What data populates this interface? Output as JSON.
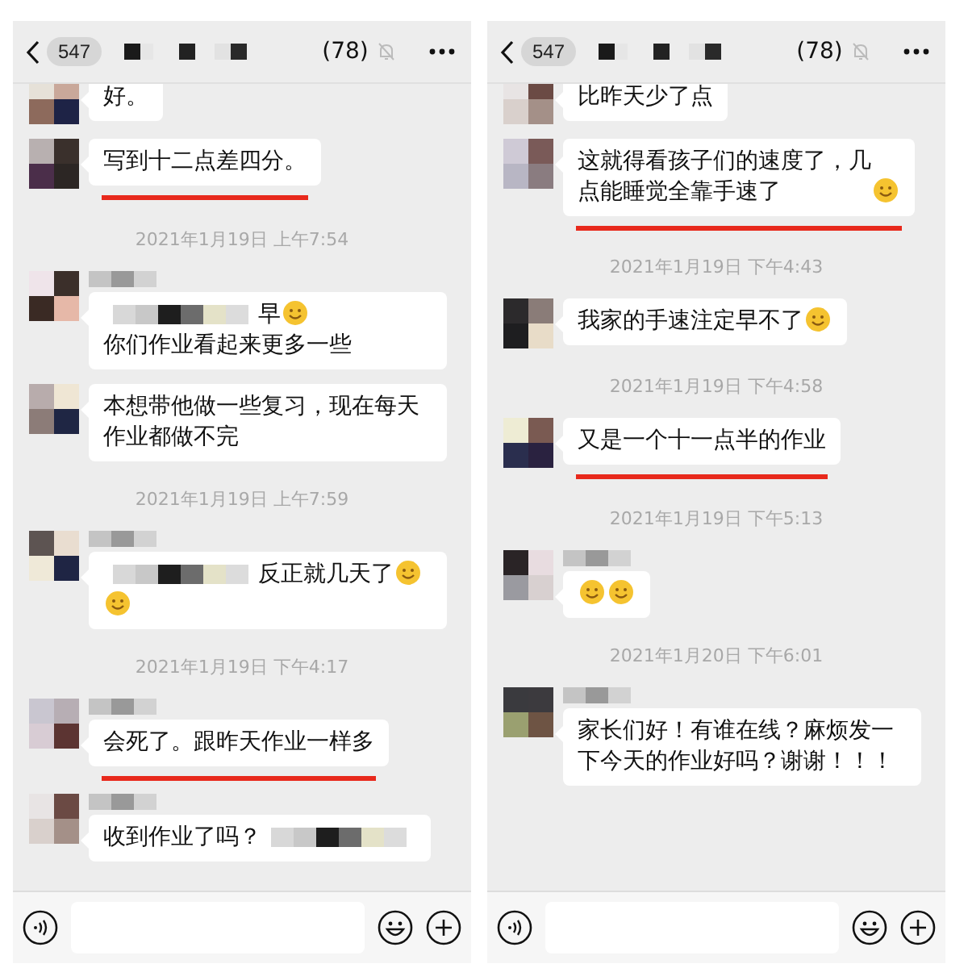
{
  "panels": [
    {
      "header": {
        "back_count": "547",
        "member_count": "(78)",
        "muted": true
      },
      "messages": [
        {
          "kind": "message",
          "name_censored": false,
          "underlined": false,
          "parts": [
            {
              "kind": "text",
              "text": "好。"
            }
          ]
        },
        {
          "kind": "message",
          "name_censored": false,
          "underlined": true,
          "parts": [
            {
              "kind": "text",
              "text": "写到十二点差四分。"
            }
          ]
        },
        {
          "kind": "time",
          "text": "2021年1月19日 上午7:54"
        },
        {
          "kind": "message",
          "name_censored": true,
          "underlined": false,
          "parts": [
            {
              "kind": "censored"
            },
            {
              "kind": "text",
              "text": "早"
            },
            {
              "kind": "emoji"
            },
            {
              "kind": "text",
              "text": "你们作业看起来更多一些"
            }
          ]
        },
        {
          "kind": "message",
          "name_censored": false,
          "underlined": false,
          "parts": [
            {
              "kind": "text",
              "text": "本想带他做一些复习，现在每天作业都做不完"
            }
          ]
        },
        {
          "kind": "time",
          "text": "2021年1月19日 上午7:59"
        },
        {
          "kind": "message",
          "name_censored": true,
          "underlined": false,
          "parts": [
            {
              "kind": "censored"
            },
            {
              "kind": "text",
              "text": "反正就几天了"
            },
            {
              "kind": "emoji"
            },
            {
              "kind": "emoji"
            }
          ]
        },
        {
          "kind": "time",
          "text": "2021年1月19日 下午4:17"
        },
        {
          "kind": "message",
          "name_censored": true,
          "underlined": true,
          "parts": [
            {
              "kind": "text",
              "text": "会死了。跟昨天作业一样多"
            }
          ]
        },
        {
          "kind": "message",
          "name_censored": true,
          "underlined": false,
          "parts": [
            {
              "kind": "text",
              "text": "收到作业了吗？"
            },
            {
              "kind": "censored"
            }
          ]
        }
      ]
    },
    {
      "header": {
        "back_count": "547",
        "member_count": "(78)",
        "muted": true
      },
      "messages": [
        {
          "kind": "message",
          "name_censored": false,
          "underlined": false,
          "parts": [
            {
              "kind": "text",
              "text": "比昨天少了点"
            }
          ]
        },
        {
          "kind": "message",
          "name_censored": false,
          "underlined": true,
          "parts": [
            {
              "kind": "text",
              "text": "这就得看孩子们的速度了，几点能睡觉全靠手速了"
            },
            {
              "kind": "emoji"
            }
          ]
        },
        {
          "kind": "time",
          "text": "2021年1月19日 下午4:43"
        },
        {
          "kind": "message",
          "name_censored": false,
          "underlined": false,
          "parts": [
            {
              "kind": "text",
              "text": "我家的手速注定早不了"
            },
            {
              "kind": "emoji"
            }
          ]
        },
        {
          "kind": "time",
          "text": "2021年1月19日 下午4:58"
        },
        {
          "kind": "message",
          "name_censored": false,
          "underlined": true,
          "parts": [
            {
              "kind": "text",
              "text": "又是一个十一点半的作业"
            }
          ]
        },
        {
          "kind": "time",
          "text": "2021年1月19日 下午5:13"
        },
        {
          "kind": "message",
          "name_censored": true,
          "underlined": false,
          "parts": [
            {
              "kind": "emoji"
            },
            {
              "kind": "emoji"
            }
          ]
        },
        {
          "kind": "time",
          "text": "2021年1月20日 下午6:01"
        },
        {
          "kind": "message",
          "name_censored": true,
          "underlined": false,
          "parts": [
            {
              "kind": "text",
              "text": "家长们好！有谁在线？麻烦发一下今天的作业好吗？谢谢！！！"
            }
          ]
        }
      ]
    }
  ]
}
